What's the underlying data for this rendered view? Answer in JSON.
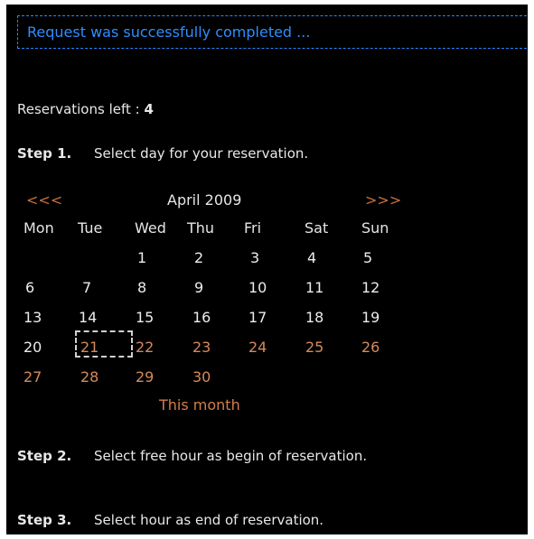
{
  "status": {
    "message": "Request was successfully completed ..."
  },
  "reservations": {
    "label": "Reservations left :",
    "count": "4"
  },
  "steps": [
    {
      "label": "Step 1.",
      "text": "Select day for your reservation."
    },
    {
      "label": "Step 2.",
      "text": "Select free hour as begin of reservation."
    },
    {
      "label": "Step 3.",
      "text": "Select hour as end of reservation."
    }
  ],
  "calendar": {
    "prev": "<<<",
    "next": ">>>",
    "month": "April 2009",
    "weekdays": [
      "Mon",
      "Tue",
      "Wed",
      "Thu",
      "Fri",
      "Sat",
      "Sun"
    ],
    "selected_day": "21",
    "this_month": "This month",
    "weeks": [
      [
        "",
        "",
        "1",
        "2",
        "3",
        "4",
        "5"
      ],
      [
        "6",
        "7",
        "8",
        "9",
        "10",
        "11",
        "12"
      ],
      [
        "13",
        "14",
        "15",
        "16",
        "17",
        "18",
        "19"
      ],
      [
        "20",
        "21",
        "22",
        "23",
        "24",
        "25",
        "26"
      ],
      [
        "27",
        "28",
        "29",
        "30",
        "",
        "",
        ""
      ]
    ]
  },
  "colors": {
    "background": "#000000",
    "status_blue": "#2e8eff",
    "text": "#e8e8e8",
    "future_day": "#d68a5c"
  }
}
